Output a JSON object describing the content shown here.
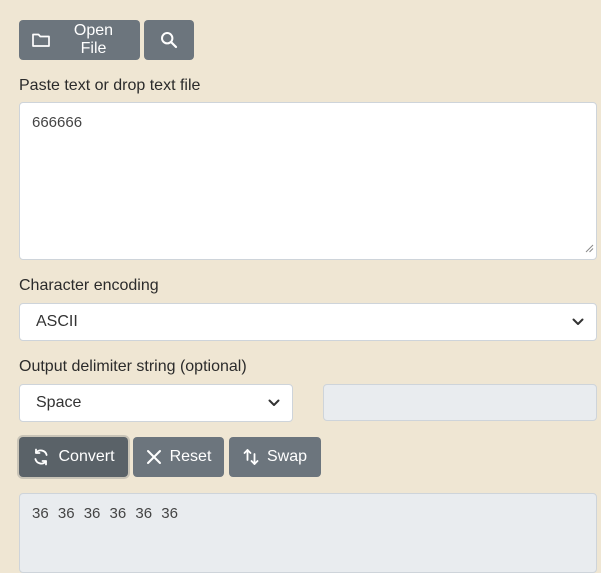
{
  "toolbar": {
    "open_file_label": "Open File",
    "open_file_icon": "folder-icon",
    "search_icon": "search-icon"
  },
  "input": {
    "label": "Paste text or drop text file",
    "value": "666666"
  },
  "encoding": {
    "label": "Character encoding",
    "selected": "ASCII"
  },
  "delimiter": {
    "label": "Output delimiter string (optional)",
    "selected": "Space",
    "custom_value": ""
  },
  "actions": {
    "convert_label": "Convert",
    "convert_icon": "refresh-icon",
    "reset_label": "Reset",
    "reset_icon": "close-icon",
    "swap_label": "Swap",
    "swap_icon": "swap-icon"
  },
  "output": {
    "value": "36 36 36 36 36 36"
  },
  "colors": {
    "background": "#efe6d3",
    "button": "#6c757d",
    "readonly": "#e9ecef"
  }
}
